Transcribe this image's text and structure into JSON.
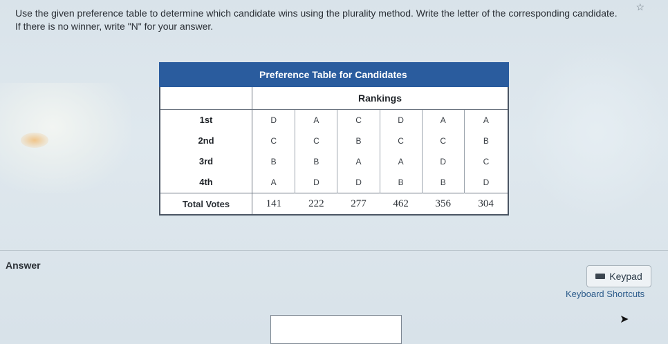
{
  "question": {
    "text": "Use the given preference table to determine which candidate wins using the plurality method. Write the letter of the corresponding candidate. If there is no winner, write \"N\" for your answer."
  },
  "table": {
    "title": "Preference Table for Candidates",
    "rankings_header": "Rankings",
    "rank_labels": [
      "1st",
      "2nd",
      "3rd",
      "4th"
    ],
    "columns": [
      {
        "ranks": [
          "D",
          "C",
          "B",
          "A"
        ],
        "votes": "141"
      },
      {
        "ranks": [
          "A",
          "C",
          "B",
          "D"
        ],
        "votes": "222"
      },
      {
        "ranks": [
          "C",
          "B",
          "A",
          "D"
        ],
        "votes": "277"
      },
      {
        "ranks": [
          "D",
          "C",
          "A",
          "B"
        ],
        "votes": "462"
      },
      {
        "ranks": [
          "A",
          "C",
          "D",
          "B"
        ],
        "votes": "356"
      },
      {
        "ranks": [
          "A",
          "B",
          "C",
          "D"
        ],
        "votes": "304"
      }
    ],
    "total_label": "Total Votes"
  },
  "answer": {
    "label": "Answer",
    "value": ""
  },
  "keypad": {
    "label": "Keypad"
  },
  "shortcuts": {
    "label": "Keyboard Shortcuts"
  },
  "icons": {
    "star": "star-icon",
    "keyboard": "keyboard-icon",
    "cursor": "mouse-cursor-icon"
  },
  "colors": {
    "table_header": "#2a5c9e"
  }
}
